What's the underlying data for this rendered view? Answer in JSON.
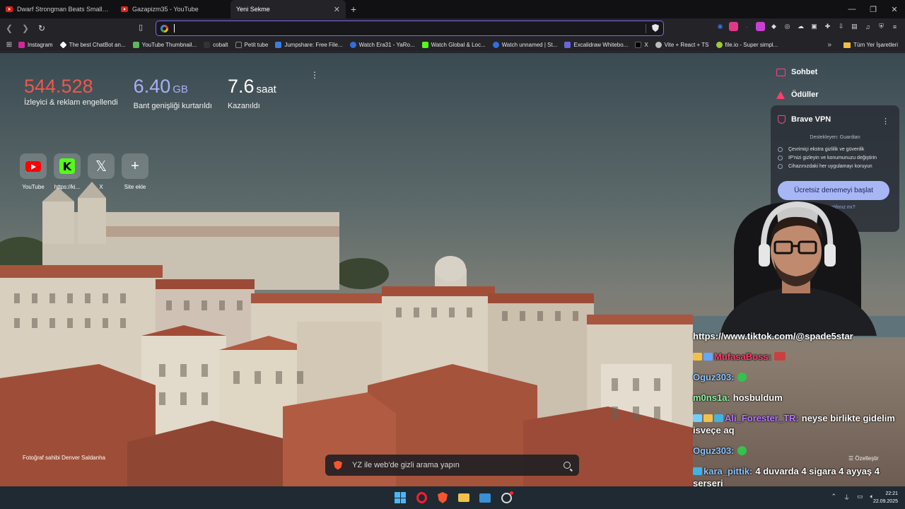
{
  "tabs": [
    {
      "title": "Dwarf Strongman Beats Smaller Opponent",
      "active": false
    },
    {
      "title": "Gazapizm35 - YouTube",
      "active": false
    },
    {
      "title": "Yeni Sekme",
      "active": true
    }
  ],
  "omnibox": {
    "value": ""
  },
  "bookmarks": [
    {
      "label": "Instagram",
      "color": "#d6249f"
    },
    {
      "label": "The best ChatBot an...",
      "color": "#ffffff"
    },
    {
      "label": "YouTube Thumbnail...",
      "color": "#5cb85c"
    },
    {
      "label": "cobalt",
      "color": "#ffffff"
    },
    {
      "label": "Petit tube",
      "color": "#222222"
    },
    {
      "label": "Jumpshare: Free File...",
      "color": "#3b7ddd"
    },
    {
      "label": "Watch Era31 - YaRo...",
      "color": "#2f6fe0"
    },
    {
      "label": "Watch Global & Loc...",
      "color": "#53fc18"
    },
    {
      "label": "Watch unnamed | St...",
      "color": "#2f6fe0"
    },
    {
      "label": "Excalidraw Whitebo...",
      "color": "#6965db"
    },
    {
      "label": "X",
      "color": "#000000"
    },
    {
      "label": "Vite + React + TS",
      "color": "#bbbbbb"
    },
    {
      "label": "file.io - Super simpl...",
      "color": "#9acd32"
    }
  ],
  "bookmarks_all": "Tüm Yer İşaretleri",
  "stats": {
    "ads_value": "544.528",
    "ads_label": "İzleyici & reklam engellendi",
    "bandwidth_value": "6.40",
    "bandwidth_unit": "GB",
    "bandwidth_label": "Bant genişliği kurtarıldı",
    "time_value": "7.6",
    "time_unit": "saat",
    "time_label": "Kazanıldı"
  },
  "top_sites": [
    {
      "label": "YouTube",
      "icon": "youtube-icon"
    },
    {
      "label": "https://ki...",
      "icon": "kick-icon"
    },
    {
      "label": "X",
      "icon": "x-icon"
    },
    {
      "label": "Site ekle",
      "icon": "plus-icon"
    }
  ],
  "side_links": {
    "chat": "Sohbet",
    "rewards": "Ödüller"
  },
  "vpn": {
    "title": "Brave VPN",
    "sponsor": "Destekleyen:  Guardian",
    "features": [
      "Çevrimiçi ekstra gizlilik ve güvenlik",
      "IP'nizi gizleyin ve konumunuzu değiştirin",
      "Cihazınızdaki her uygulamayı koruyun"
    ],
    "button": "Ücretsiz denemeyi başlat",
    "link": "...satın aldınız mı?"
  },
  "chat": {
    "header": "https://www.tiktok.com/@spade5star",
    "messages": [
      {
        "user": "MufasaBoss:",
        "text": "",
        "color": "#ff3d6e",
        "emote": "red"
      },
      {
        "user": "Oguz303:",
        "text": "",
        "color": "#8ec5ff",
        "emote": "green"
      },
      {
        "user": "m0ns1a:",
        "text": "hosbuldum",
        "color": "#8ff3a8",
        "emote": ""
      },
      {
        "user": "Ali_Forester_TR:",
        "text": "neyse birlikte gidelim isveçe aq",
        "color": "#b57cff",
        "emote": ""
      },
      {
        "user": "Oguz303:",
        "text": "",
        "color": "#8ec5ff",
        "emote": "green"
      },
      {
        "user": "kara_pittik:",
        "text": "4 duvarda 4 sigara 4 ayyaş 4 serseri",
        "color": "#8ec5ff",
        "emote": ""
      }
    ]
  },
  "customize": "Özelleştir",
  "photo_credit": "Fotoğraf sahibi Denver Saldanha",
  "search": {
    "placeholder": "YZ ile web'de gizli arama yapın"
  },
  "clock": {
    "time": "22:21",
    "date": "22.09.2025"
  }
}
